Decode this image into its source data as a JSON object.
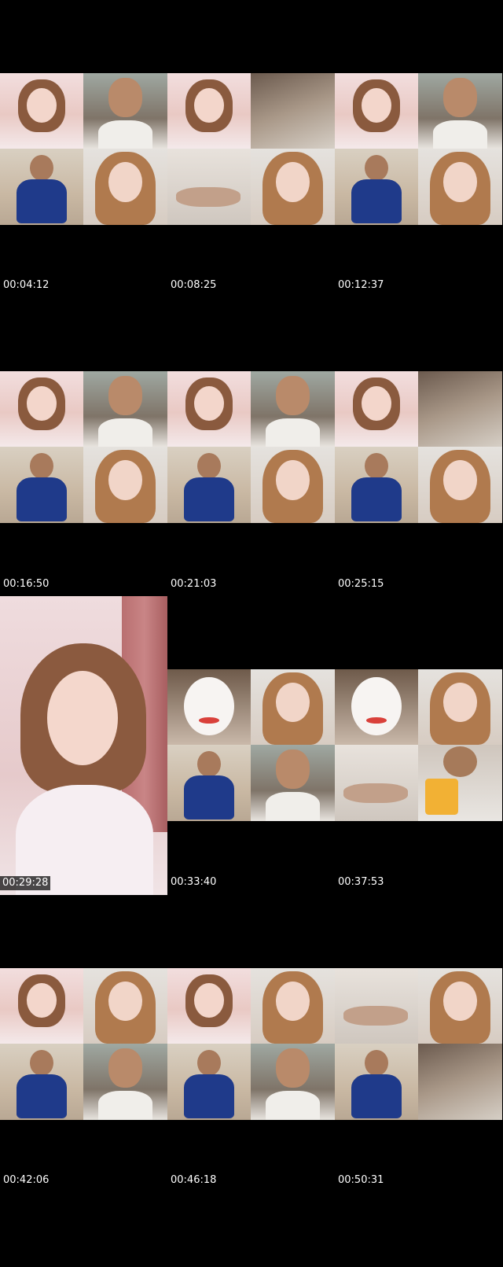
{
  "timestamps": [
    "00:04:12",
    "00:08:25",
    "00:12:37",
    "00:16:50",
    "00:21:03",
    "00:25:15",
    "00:29:28",
    "00:33:40",
    "00:37:53",
    "00:42:06",
    "00:46:18",
    "00:50:31"
  ]
}
